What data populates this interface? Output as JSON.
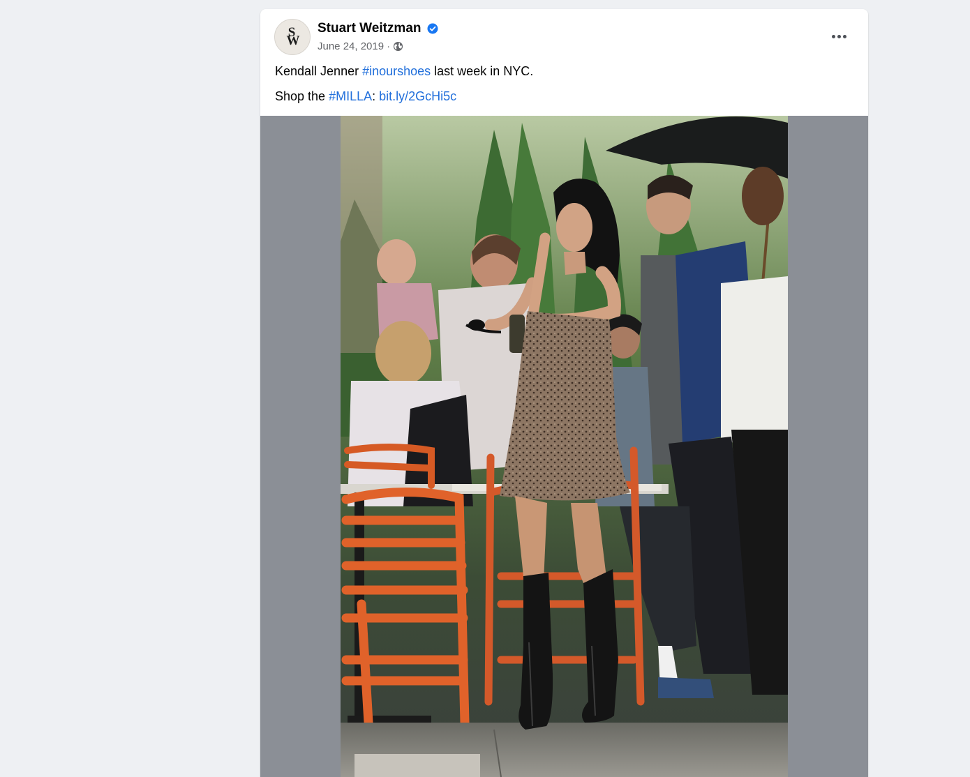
{
  "post": {
    "author": {
      "name": "Stuart Weitzman",
      "avatar_letters": [
        "S",
        "W"
      ],
      "verified": true
    },
    "meta": {
      "date": "June 24, 2019",
      "separator": "·",
      "audience_icon": "globe-icon"
    },
    "menu_icon": "more-options-icon",
    "text": {
      "line1": {
        "before": "Kendall Jenner ",
        "hashtag": "#inourshoes",
        "after": " last week in NYC."
      },
      "line2": {
        "before": "Shop the ",
        "hashtag": "#MILLA",
        "colon": ": ",
        "link": "bit.ly/2GcHi5c"
      }
    },
    "media": {
      "type": "photo"
    }
  },
  "colors": {
    "link": "#216fdb",
    "verified_badge": "#1877f2",
    "media_letterbox": "#8b8f96",
    "page_bg": "#eef0f3"
  }
}
